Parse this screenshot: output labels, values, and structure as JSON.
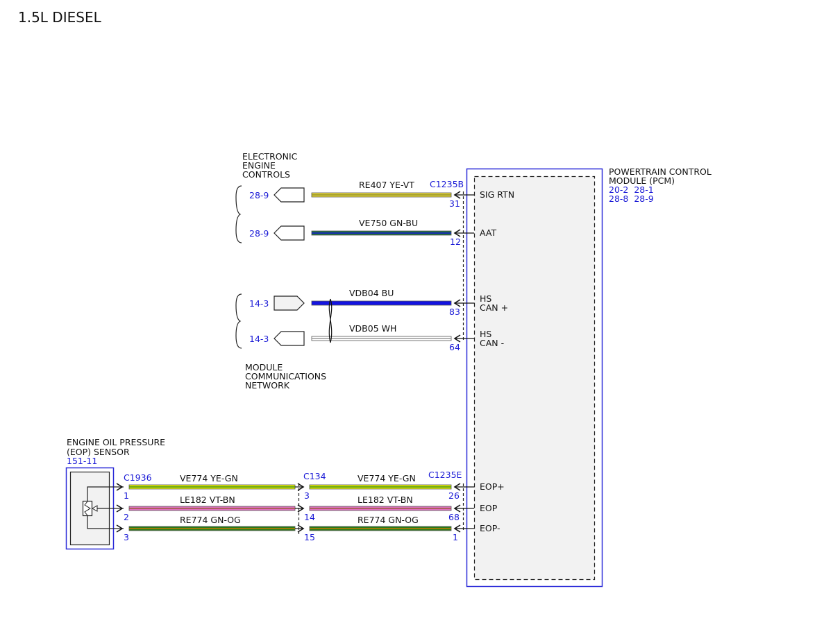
{
  "title": "1.5L DIESEL",
  "colors": {
    "YE-VT": [
      "#e8d838",
      "#8c8c2a"
    ],
    "GN-BU": [
      "#1d6e3c",
      "#1818d8"
    ],
    "BU": [
      "#1414e0",
      "#1414e0"
    ],
    "WH": [
      "#ffffff",
      "#9a9a9a"
    ],
    "YE-GN": [
      "#e8f000",
      "#3a8c1a"
    ],
    "VT-BN": [
      "#e070c0",
      "#9a5a3a"
    ],
    "GN-OG": [
      "#2a7a1a",
      "#c08000"
    ],
    "blue_ref": "#1a1ad6"
  },
  "pcm": {
    "name_line1": "POWERTRAIN CONTROL",
    "name_line2": "MODULE (PCM)",
    "refs_line1": "20-2  28-1",
    "refs_line2": "28-8  28-9",
    "connector_b": "C1235B",
    "connector_e": "C1235E"
  },
  "electronic_engine_controls": {
    "line1": "ELECTRONIC",
    "line2": "ENGINE",
    "line3": "CONTROLS"
  },
  "module_network": {
    "line1": "MODULE",
    "line2": "COMMUNICATIONS",
    "line3": "NETWORK"
  },
  "top_circuits": [
    {
      "ref": "28-9",
      "circuit": "RE407  YE-VT",
      "pin": "31",
      "signal_line1": "SIG RTN",
      "signal_line2": "",
      "color": "YE-VT"
    },
    {
      "ref": "28-9",
      "circuit": "VE750  GN-BU",
      "pin": "12",
      "signal_line1": "AAT",
      "signal_line2": "",
      "color": "GN-BU"
    },
    {
      "ref": "14-3",
      "circuit": "VDB04  BU",
      "pin": "83",
      "signal_line1": "HS",
      "signal_line2": "CAN +",
      "color": "BU"
    },
    {
      "ref": "14-3",
      "circuit": "VDB05  WH",
      "pin": "64",
      "signal_line1": "HS",
      "signal_line2": "CAN -",
      "color": "WH"
    }
  ],
  "eop_sensor": {
    "line1": "ENGINE OIL PRESSURE",
    "line2": "(EOP) SENSOR",
    "ref": "151-11",
    "connector": "C1936"
  },
  "inline_connector": "C134",
  "eop_circuits": [
    {
      "circuit": "VE774   YE-GN",
      "sensor_pin": "1",
      "c134_pin": "3",
      "pcm_pin": "26",
      "signal": "EOP+",
      "color": "YE-GN"
    },
    {
      "circuit": "LE182   VT-BN",
      "sensor_pin": "2",
      "c134_pin": "14",
      "pcm_pin": "68",
      "signal": "EOP",
      "color": "VT-BN"
    },
    {
      "circuit": "RE774   GN-OG",
      "sensor_pin": "3",
      "c134_pin": "15",
      "pcm_pin": "1",
      "signal": "EOP-",
      "color": "GN-OG"
    }
  ]
}
